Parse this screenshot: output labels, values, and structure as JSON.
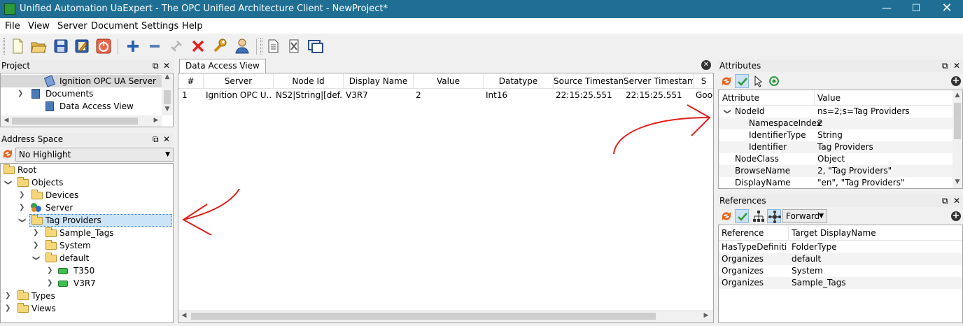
{
  "window": {
    "title": "Unified Automation UaExpert - The OPC Unified Architecture Client - NewProject*",
    "minimize_icon": "minimize-icon",
    "maximize_icon": "maximize-icon",
    "close_icon": "close-icon"
  },
  "menu": [
    "File",
    "View",
    "Server",
    "Document",
    "Settings",
    "Help"
  ],
  "toolbar": {
    "buttons": [
      "new-document-icon",
      "open-folder-icon",
      "save-icon",
      "save-as-icon",
      "power-icon",
      "add-server-icon",
      "remove-server-icon",
      "connect-icon",
      "disconnect-icon",
      "settings-wrench-icon",
      "user-icon",
      "document-icon",
      "remove-document-icon",
      "window-icon"
    ]
  },
  "project": {
    "title": "Project",
    "items": [
      {
        "label": "Ignition OPC UA Server"
      },
      {
        "label": "Documents"
      },
      {
        "label": "Data Access View"
      }
    ]
  },
  "address_space": {
    "title": "Address Space",
    "highlight_value": "No Highlight",
    "tree": [
      {
        "label": "Root"
      },
      {
        "label": "Objects"
      },
      {
        "label": "Devices"
      },
      {
        "label": "Server"
      },
      {
        "label": "Tag Providers"
      },
      {
        "label": "Sample_Tags"
      },
      {
        "label": "System"
      },
      {
        "label": "default"
      },
      {
        "label": "T350"
      },
      {
        "label": "V3R7"
      },
      {
        "label": "Types"
      },
      {
        "label": "Views"
      }
    ]
  },
  "data_access_view": {
    "tab_label": "Data Access View",
    "columns": [
      "#",
      "Server",
      "Node Id",
      "Display Name",
      "Value",
      "Datatype",
      "Source Timestamp",
      "Server Timestamp",
      "S"
    ],
    "rows": [
      {
        "num": "1",
        "server": "Ignition OPC U...",
        "node_id": "NS2|String|[def...",
        "display_name": "V3R7",
        "value": "2",
        "datatype": "Int16",
        "source_ts": "22:15:25.551",
        "server_ts": "22:15:25.551",
        "status": "Good"
      }
    ]
  },
  "attributes": {
    "title": "Attributes",
    "columns": [
      "Attribute",
      "Value"
    ],
    "rows": [
      {
        "attr": "NodeId",
        "value": "ns=2;s=Tag Providers"
      },
      {
        "attr": "NamespaceIndex",
        "value": "2"
      },
      {
        "attr": "IdentifierType",
        "value": "String"
      },
      {
        "attr": "Identifier",
        "value": "Tag Providers"
      },
      {
        "attr": "NodeClass",
        "value": "Object"
      },
      {
        "attr": "BrowseName",
        "value": "2, \"Tag Providers\""
      },
      {
        "attr": "DisplayName",
        "value": "\"en\", \"Tag Providers\""
      }
    ]
  },
  "references": {
    "title": "References",
    "direction": "Forward",
    "columns": [
      "Reference",
      "Target DisplayName"
    ],
    "rows": [
      {
        "ref": "HasTypeDefiniti...",
        "target": "FolderType"
      },
      {
        "ref": "Organizes",
        "target": "default"
      },
      {
        "ref": "Organizes",
        "target": "System"
      },
      {
        "ref": "Organizes",
        "target": "Sample_Tags"
      }
    ]
  },
  "colors": {
    "titlebar": "#1f6f94",
    "annotation_red": "#e0201c",
    "selection": "#cce4f7"
  }
}
